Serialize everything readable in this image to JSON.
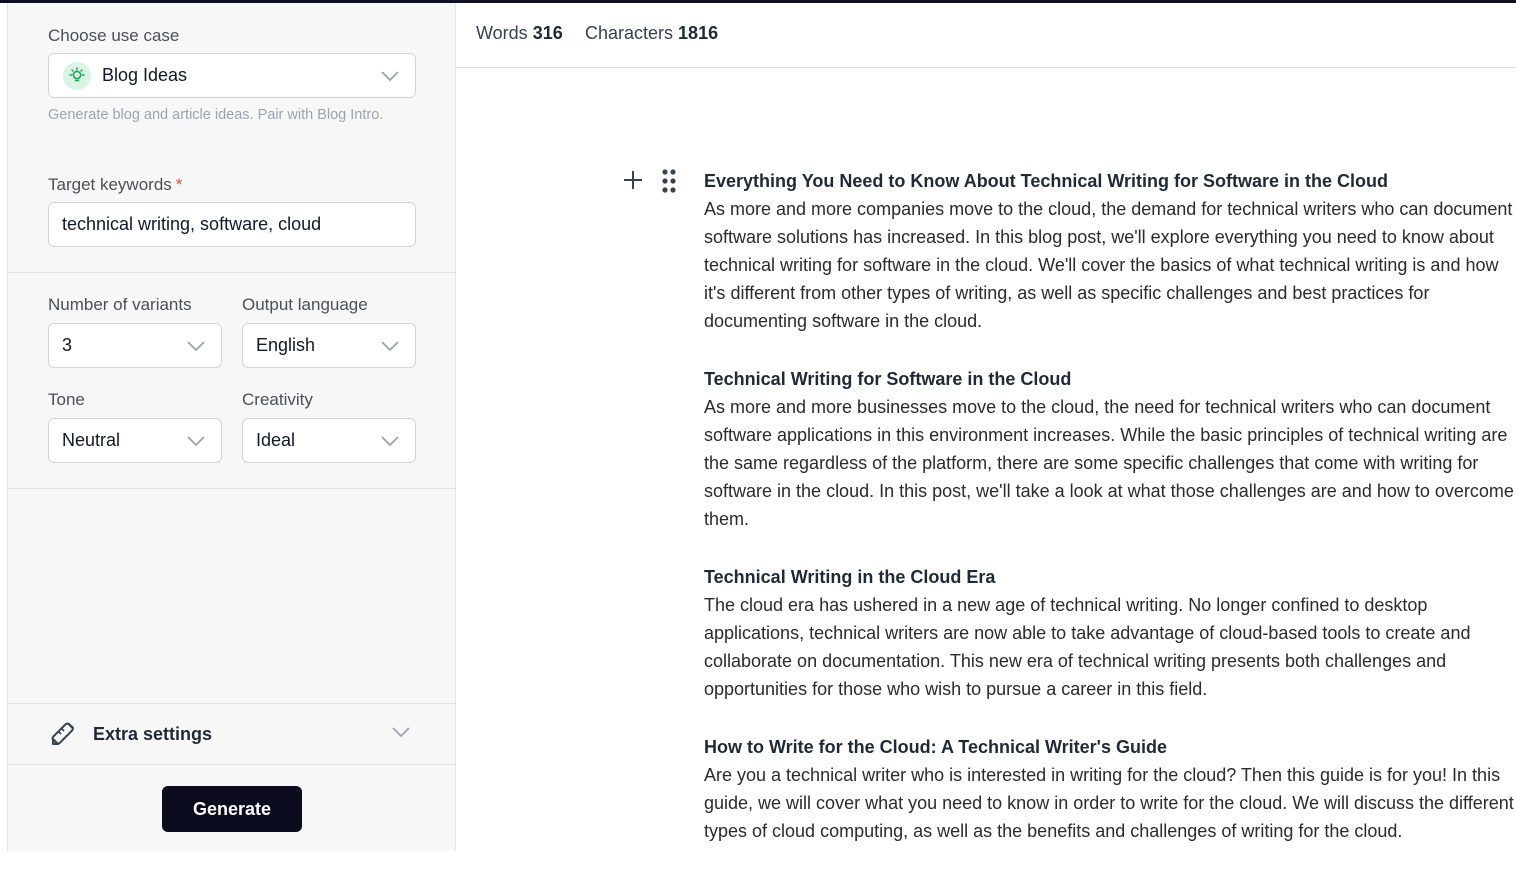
{
  "sidebar": {
    "use_case_label": "Choose use case",
    "use_case_value": "Blog Ideas",
    "use_case_hint": "Generate blog and article ideas. Pair with Blog Intro.",
    "keywords_label": "Target keywords",
    "keywords_required": "*",
    "keywords_value": "technical writing, software, cloud",
    "variants_label": "Number of variants",
    "variants_value": "3",
    "language_label": "Output language",
    "language_value": "English",
    "tone_label": "Tone",
    "tone_value": "Neutral",
    "creativity_label": "Creativity",
    "creativity_value": "Ideal",
    "extra_settings_label": "Extra settings",
    "generate_label": "Generate"
  },
  "stats": {
    "words_label": "Words",
    "words_value": "316",
    "characters_label": "Characters",
    "characters_value": "1816"
  },
  "content": {
    "blocks": [
      {
        "title": "Everything You Need to Know About Technical Writing for Software in the Cloud",
        "body": "As more and more companies move to the cloud, the demand for technical writers who can document software solutions has increased. In this blog post, we'll explore everything you need to know about technical writing for software in the cloud. We'll cover the basics of what technical writing is and how it's different from other types of writing, as well as specific challenges and best practices for documenting software in the cloud."
      },
      {
        "title": "Technical Writing for Software in the Cloud",
        "body": "As more and more businesses move to the cloud, the need for technical writers who can document software applications in this environment increases. While the basic principles of technical writing are the same regardless of the platform, there are some specific challenges that come with writing for software in the cloud. In this post, we'll take a look at what those challenges are and how to overcome them."
      },
      {
        "title": "Technical Writing in the Cloud Era",
        "body": "The cloud era has ushered in a new age of technical writing. No longer confined to desktop applications, technical writers are now able to take advantage of cloud-based tools to create and collaborate on documentation. This new era of technical writing presents both challenges and opportunities for those who wish to pursue a career in this field."
      },
      {
        "title": "How to Write for the Cloud: A Technical Writer's Guide",
        "body": "Are you a technical writer who is interested in writing for the cloud? Then this guide is for you! In this guide, we will cover what you need to know in order to write for the cloud. We will discuss the different types of cloud computing, as well as the benefits and challenges of writing for the cloud."
      }
    ]
  },
  "colors": {
    "accent_dark": "#0b0b1e",
    "required": "#ef4444",
    "usecase_icon_bg": "#d8f5e3",
    "usecase_icon_fg": "#16a34a"
  },
  "icons": {
    "usecase": "lightbulb-icon",
    "extra_settings": "tools-icon",
    "add_block": "plus-icon",
    "drag_handle": "drag-handle-icon",
    "dropdown": "chevron-down-icon"
  }
}
